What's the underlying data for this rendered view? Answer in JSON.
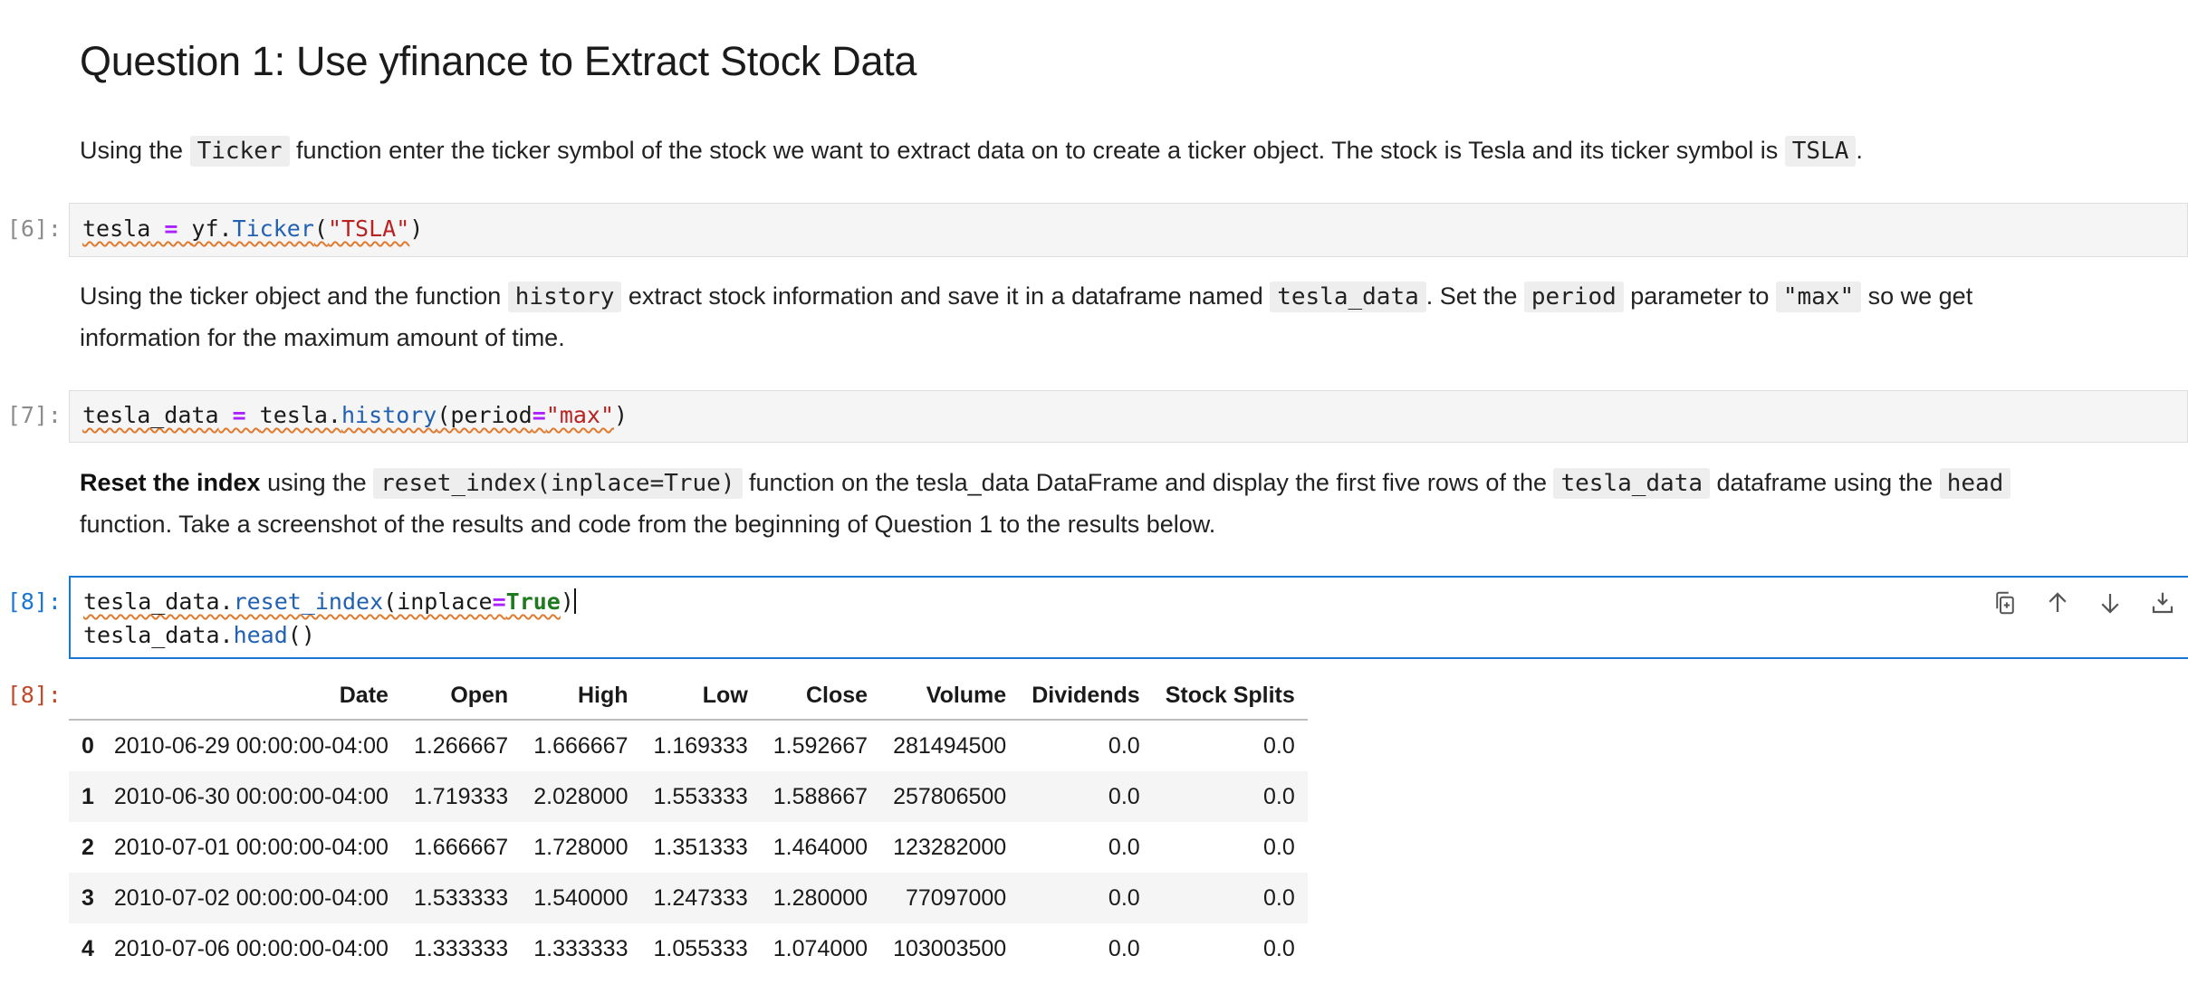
{
  "heading": "Question 1: Use yfinance to Extract Stock Data",
  "para1": {
    "t1": "Using the ",
    "c1": "Ticker",
    "t2": " function enter the ticker symbol of the stock we want to extract data on to create a ticker object. The stock is Tesla and its ticker symbol is ",
    "c2": "TSLA",
    "t3": "."
  },
  "cell1": {
    "prompt": "[6]:",
    "v1": "tesla",
    "op": " = ",
    "mod": "yf.",
    "fn": "Ticker",
    "p1": "(",
    "str": "\"TSLA\"",
    "p2": ")"
  },
  "para2": {
    "t1": "Using the ticker object and the function ",
    "c1": "history",
    "t2": " extract stock information and save it in a dataframe named ",
    "c2": "tesla_data",
    "t3": ". Set the ",
    "c3": "period",
    "t4": " parameter to ",
    "c4": "\"max\"",
    "t5": " so we get",
    "line2": "information for the maximum amount of time."
  },
  "cell2": {
    "prompt": "[7]:",
    "v1": "tesla_data",
    "op": " = ",
    "obj": "tesla.",
    "fn": "history",
    "p1": "(period",
    "eq": "=",
    "str": "\"max\"",
    "p2": ")"
  },
  "para3": {
    "b1": "Reset the index",
    "t1": " using the ",
    "c1": "reset_index(inplace=True)",
    "t2": " function on the tesla_data DataFrame and display the first five rows of the ",
    "c2": "tesla_data",
    "t3": " dataframe using the ",
    "c3": "head",
    "line2": "function. Take a screenshot of the results and code from the beginning of Question 1 to the results below."
  },
  "cell3": {
    "prompt": "[8]:",
    "l1_obj": "tesla_data.",
    "l1_fn": "reset_index",
    "l1_p1": "(inplace",
    "l1_eq": "=",
    "l1_kw": "True",
    "l1_p2": ")",
    "l2_obj": "tesla_data.",
    "l2_fn": "head",
    "l2_p": "()"
  },
  "output": {
    "prompt": "[8]:",
    "columns": [
      "",
      "Date",
      "Open",
      "High",
      "Low",
      "Close",
      "Volume",
      "Dividends",
      "Stock Splits"
    ],
    "rows": [
      [
        "0",
        "2010-06-29 00:00:00-04:00",
        "1.266667",
        "1.666667",
        "1.169333",
        "1.592667",
        "281494500",
        "0.0",
        "0.0"
      ],
      [
        "1",
        "2010-06-30 00:00:00-04:00",
        "1.719333",
        "2.028000",
        "1.553333",
        "1.588667",
        "257806500",
        "0.0",
        "0.0"
      ],
      [
        "2",
        "2010-07-01 00:00:00-04:00",
        "1.666667",
        "1.728000",
        "1.351333",
        "1.464000",
        "123282000",
        "0.0",
        "0.0"
      ],
      [
        "3",
        "2010-07-02 00:00:00-04:00",
        "1.533333",
        "1.540000",
        "1.247333",
        "1.280000",
        "77097000",
        "0.0",
        "0.0"
      ],
      [
        "4",
        "2010-07-06 00:00:00-04:00",
        "1.333333",
        "1.333333",
        "1.055333",
        "1.074000",
        "103003500",
        "0.0",
        "0.0"
      ]
    ]
  },
  "toolbar_icons": [
    "duplicate-icon",
    "move-up-icon",
    "move-down-icon",
    "insert-below-icon"
  ]
}
